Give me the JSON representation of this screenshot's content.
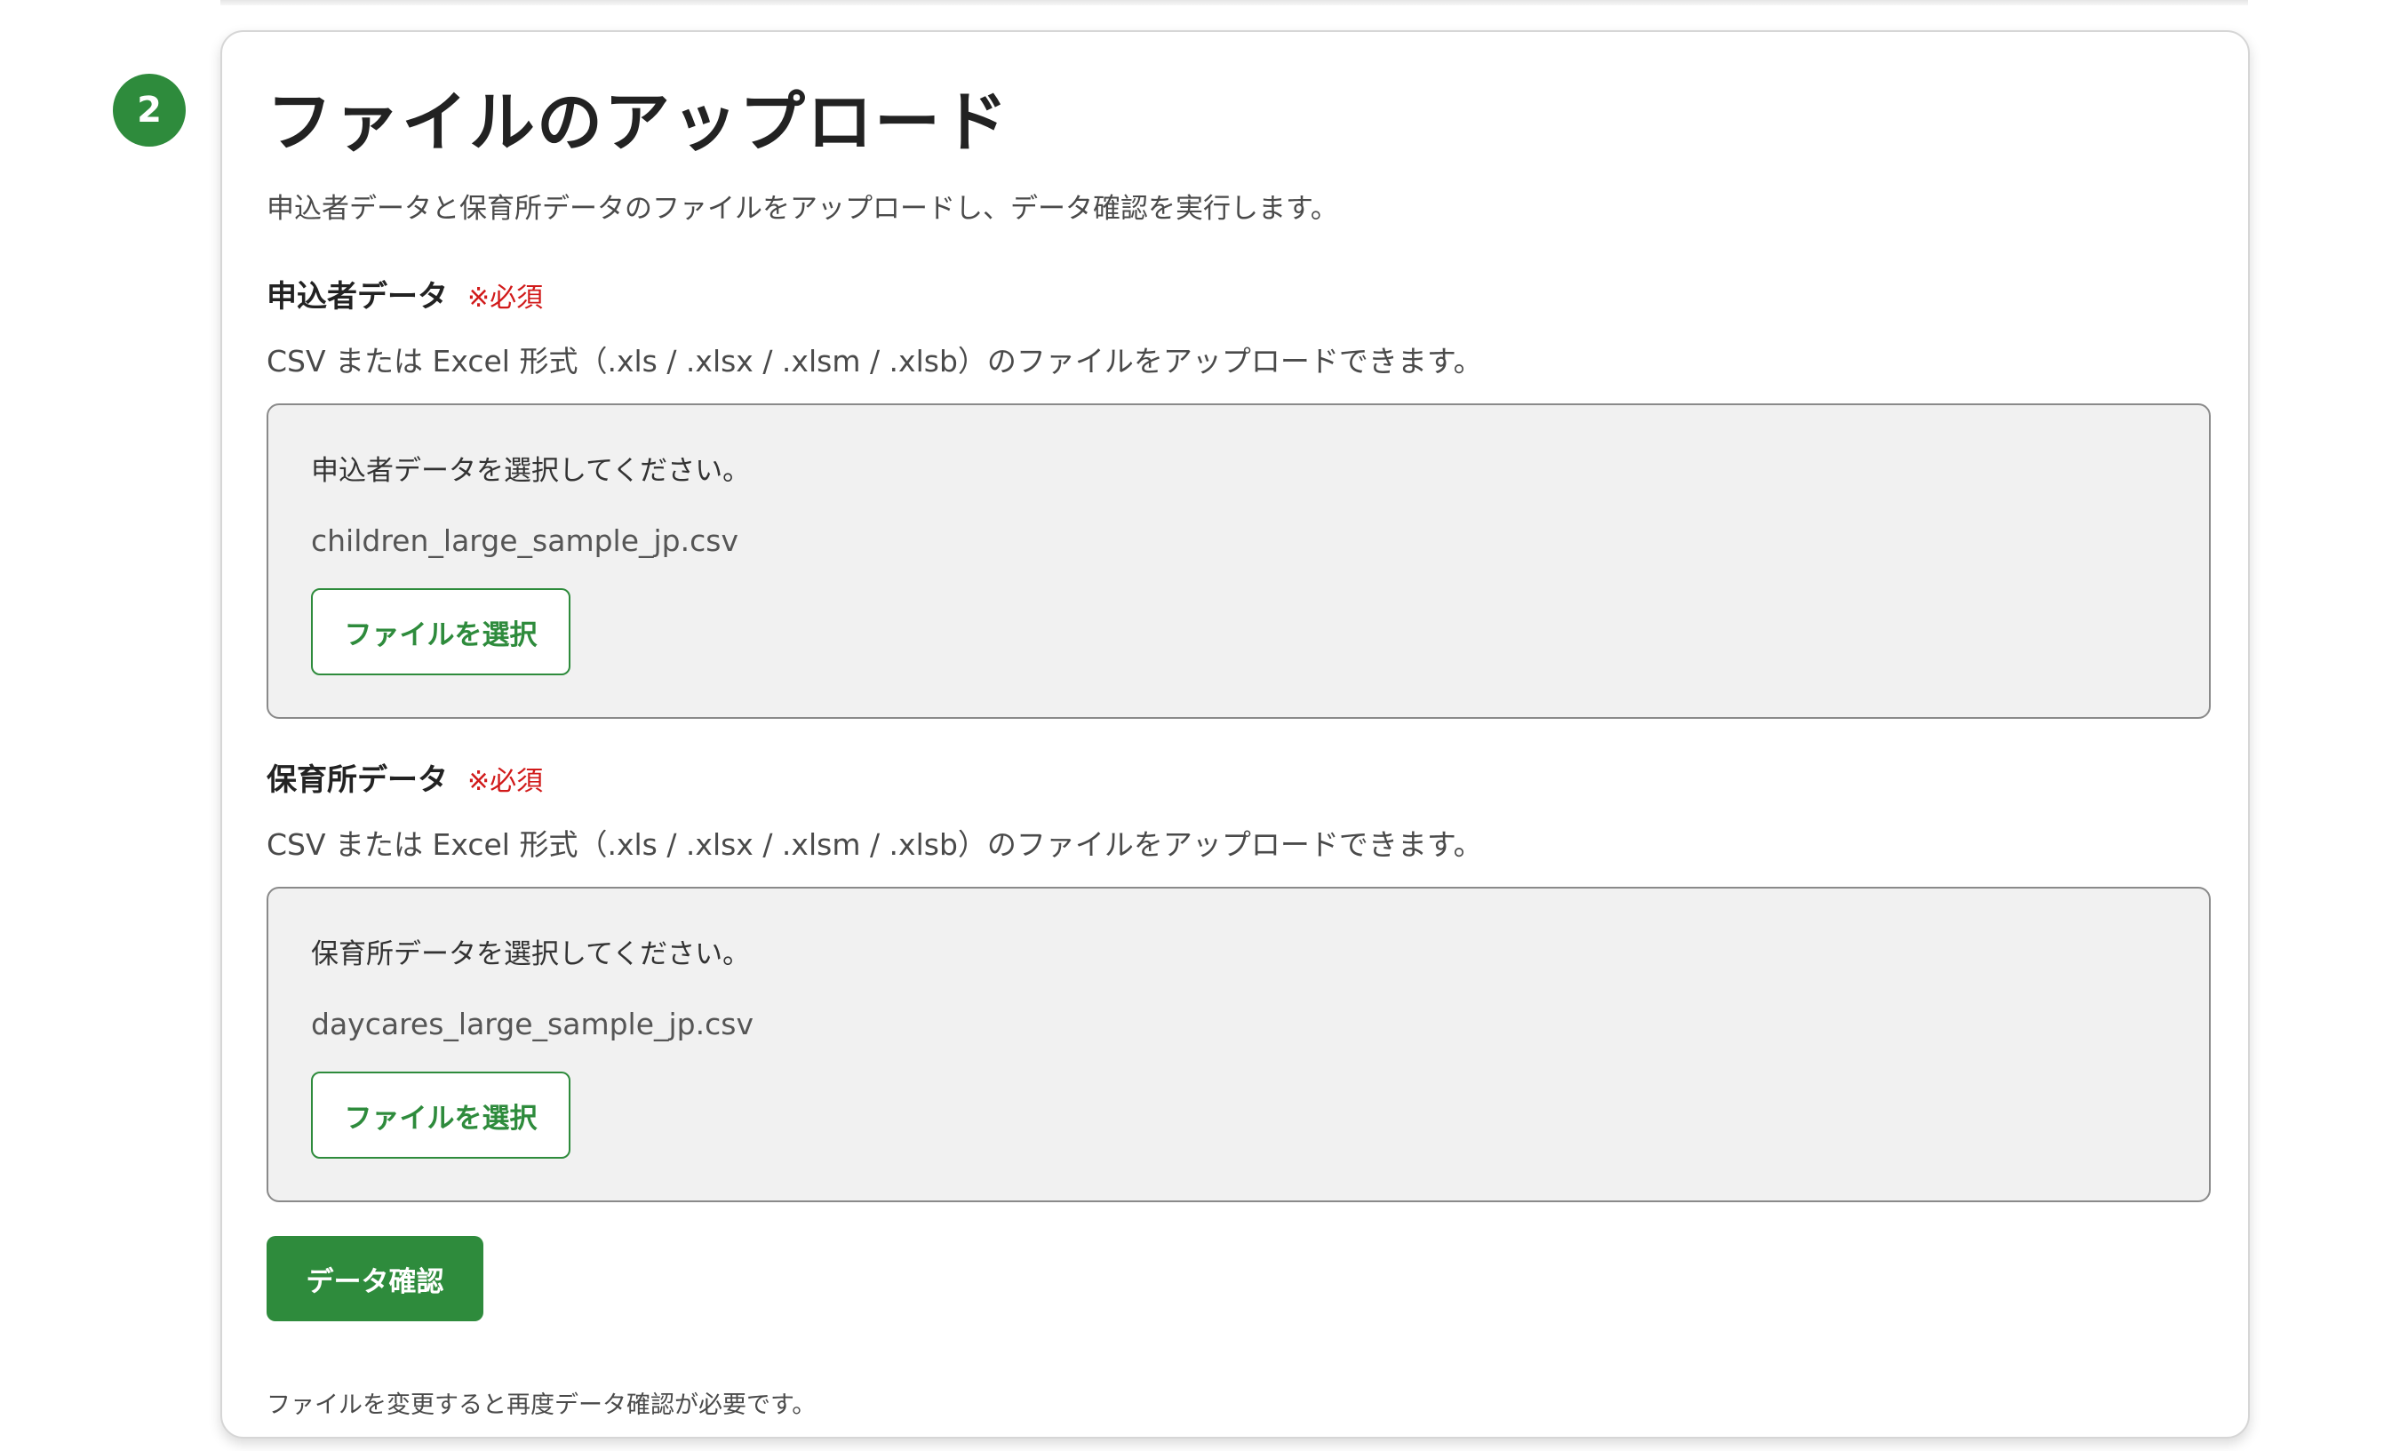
{
  "step": {
    "number": "2"
  },
  "section": {
    "title": "ファイルのアップロード",
    "description": "申込者データと保育所データのファイルをアップロードし、データ確認を実行します。"
  },
  "applicant": {
    "label": "申込者データ",
    "required": "※必須",
    "help": "CSV または Excel 形式（.xls / .xlsx / .xlsm / .xlsb）のファイルをアップロードできます。",
    "prompt": "申込者データを選択してください。",
    "filename": "children_large_sample_jp.csv",
    "button_label": "ファイルを選択"
  },
  "daycare": {
    "label": "保育所データ",
    "required": "※必須",
    "help": "CSV または Excel 形式（.xls / .xlsx / .xlsm / .xlsb）のファイルをアップロードできます。",
    "prompt": "保育所データを選択してください。",
    "filename": "daycares_large_sample_jp.csv",
    "button_label": "ファイルを選択"
  },
  "actions": {
    "confirm_label": "データ確認",
    "note": "ファイルを変更すると再度データ確認が必要です。"
  },
  "colors": {
    "accent": "#2e8b3c",
    "required": "#d11a1a",
    "dropzone_bg": "#f1f1f1"
  }
}
